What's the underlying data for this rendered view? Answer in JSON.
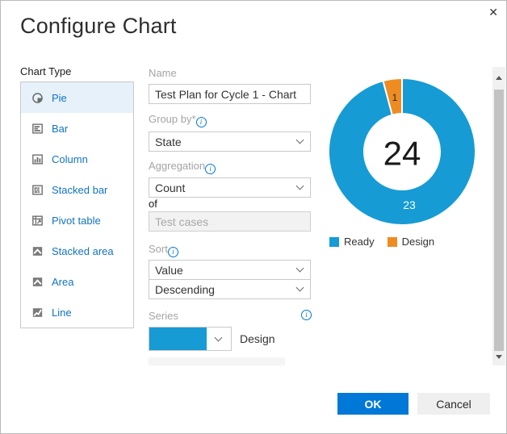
{
  "window": {
    "title": "Configure Chart",
    "close_icon": "✕"
  },
  "chart_type": {
    "label": "Chart Type",
    "items": [
      {
        "label": "Pie",
        "selected": true
      },
      {
        "label": "Bar",
        "selected": false
      },
      {
        "label": "Column",
        "selected": false
      },
      {
        "label": "Stacked bar",
        "selected": false
      },
      {
        "label": "Pivot table",
        "selected": false
      },
      {
        "label": "Stacked area",
        "selected": false
      },
      {
        "label": "Area",
        "selected": false
      },
      {
        "label": "Line",
        "selected": false
      }
    ]
  },
  "form": {
    "name_label": "Name",
    "name_value": "Test Plan for Cycle 1 - Chart",
    "group_by_label": "Group by*",
    "group_by_value": "State",
    "aggregation_label": "Aggregation",
    "aggregation_value": "Count",
    "of_label": "of",
    "of_value": "Test cases",
    "sort_label": "Sort",
    "sort_value": "Value",
    "sort_direction_value": "Descending",
    "series_label": "Series",
    "series_rows": [
      {
        "color": "#169bd5",
        "name": "Design"
      }
    ]
  },
  "chart_data": {
    "type": "pie",
    "subtype": "donut",
    "total": 24,
    "center_label": "24",
    "segments": [
      {
        "label": "Ready",
        "value": 23,
        "color": "#169bd5"
      },
      {
        "label": "Design",
        "value": 1,
        "color": "#ef8c21"
      }
    ],
    "legend": [
      {
        "label": "Ready",
        "color": "#169bd5"
      },
      {
        "label": "Design",
        "color": "#ef8c21"
      }
    ],
    "legend_position": "bottom"
  },
  "buttons": {
    "ok": "OK",
    "cancel": "Cancel"
  },
  "colors": {
    "accent": "#0078d7",
    "link": "#1173c4",
    "selected_row_bg": "#e6f1fa",
    "series_blue": "#169bd5",
    "series_orange": "#ef8c21"
  }
}
